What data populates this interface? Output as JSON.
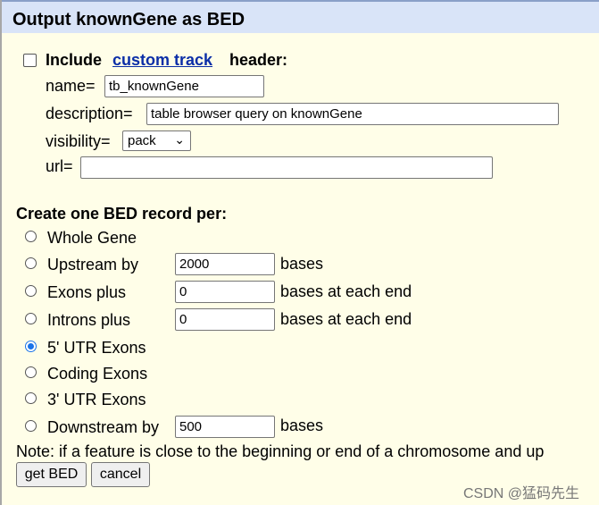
{
  "title": "Output knownGene as BED",
  "header_option": {
    "include_prefix": "Include",
    "custom_track_link": "custom track",
    "header_suffix": "header:",
    "checked": false
  },
  "fields": {
    "name_label": "name=",
    "name_value": "tb_knownGene",
    "description_label": "description=",
    "description_value": "table browser query on knownGene",
    "visibility_label": "visibility=",
    "visibility_value": "pack",
    "url_label": "url=",
    "url_value": ""
  },
  "record_section": {
    "heading": "Create one BED record per:",
    "options": [
      {
        "label": "Whole Gene",
        "selected": false
      },
      {
        "label": "Upstream by",
        "value": "2000",
        "suffix": "bases",
        "selected": false
      },
      {
        "label": "Exons plus",
        "value": "0",
        "suffix": "bases at each end",
        "selected": false
      },
      {
        "label": "Introns plus",
        "value": "0",
        "suffix": "bases at each end",
        "selected": false
      },
      {
        "label": "5' UTR Exons",
        "selected": true
      },
      {
        "label": "Coding Exons",
        "selected": false
      },
      {
        "label": "3' UTR Exons",
        "selected": false
      },
      {
        "label": "Downstream by",
        "value": "500",
        "suffix": "bases",
        "selected": false
      }
    ]
  },
  "note": "Note: if a feature is close to the beginning or end of a chromosome and up",
  "buttons": {
    "get_bed": "get BED",
    "cancel": "cancel"
  },
  "watermark": "CSDN @猛码先生"
}
